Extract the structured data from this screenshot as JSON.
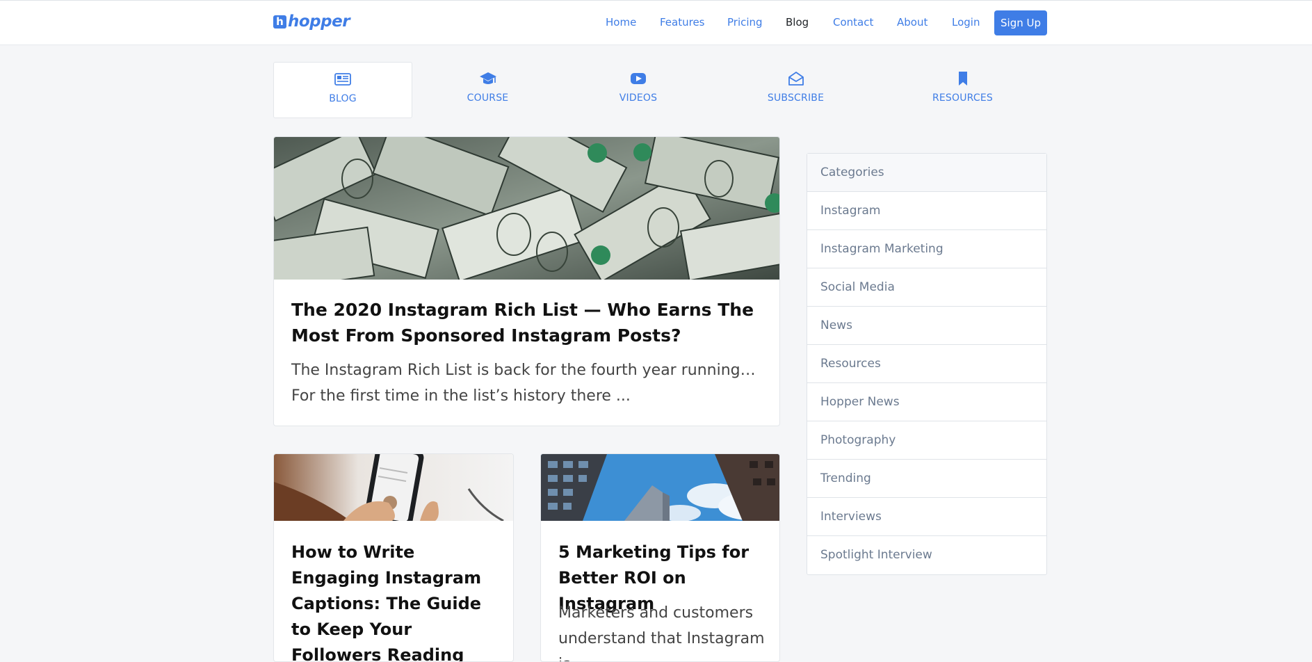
{
  "header": {
    "logo_letter": "h",
    "logo_text": "hopper",
    "nav": [
      "Home",
      "Features",
      "Pricing",
      "Blog",
      "Contact",
      "About",
      "Login"
    ],
    "active_nav": "Blog",
    "signup_label": "Sign Up"
  },
  "tabs": [
    {
      "label": "BLOG",
      "icon": "newspaper-icon"
    },
    {
      "label": "COURSE",
      "icon": "graduation-cap-icon"
    },
    {
      "label": "VIDEOS",
      "icon": "youtube-play-icon"
    },
    {
      "label": "SUBSCRIBE",
      "icon": "envelope-open-icon"
    },
    {
      "label": "RESOURCES",
      "icon": "bookmark-icon"
    }
  ],
  "posts": {
    "featured": {
      "image": "dollar-bills-photo",
      "title": "The 2020 Instagram Rich List — Who Earns The Most From Sponsored Instagram Posts?",
      "excerpt": "The Instagram Rich List is back for the fourth year running… For the first time in the list’s history there ..."
    },
    "left": {
      "image": "phone-in-hands-photo",
      "title": "How to Write Engaging Instagram Captions: The Guide to Keep Your Followers Reading"
    },
    "right": {
      "image": "buildings-sky-photo",
      "title": "5 Marketing Tips for Better ROI on Instagram",
      "excerpt": "Marketers and customers understand that Instagram is"
    }
  },
  "sidebar": {
    "heading": "Categories",
    "items": [
      "Instagram",
      "Instagram Marketing",
      "Social Media",
      "News",
      "Resources",
      "Hopper News",
      "Photography",
      "Trending",
      "Interviews",
      "Spotlight Interview"
    ]
  },
  "colors": {
    "accent": "#3f7de6",
    "background": "#f5f6f8"
  }
}
